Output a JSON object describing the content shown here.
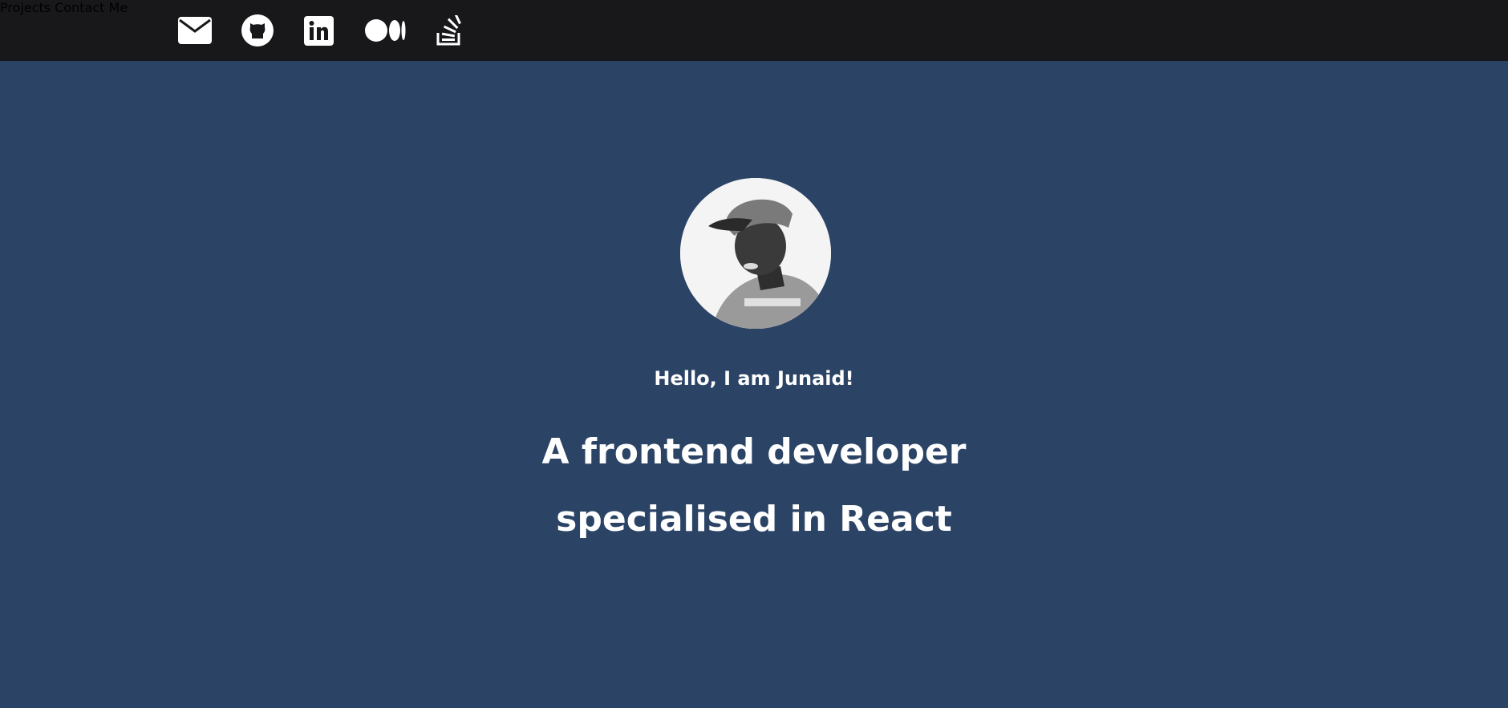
{
  "nav": {
    "social_icons": [
      "envelope-icon",
      "github-icon",
      "linkedin-icon",
      "medium-icon",
      "stackoverflow-icon"
    ],
    "links": [
      {
        "label": "Projects"
      },
      {
        "label": "Contact Me"
      }
    ]
  },
  "hero": {
    "avatar_alt": "profile photo",
    "greeting": "Hello, I am Junaid!",
    "headline_line1": "A frontend developer",
    "headline_line2": "specialised in React"
  },
  "colors": {
    "nav_background": "#18181b",
    "page_background": "#2b4365",
    "text": "#ffffff"
  }
}
